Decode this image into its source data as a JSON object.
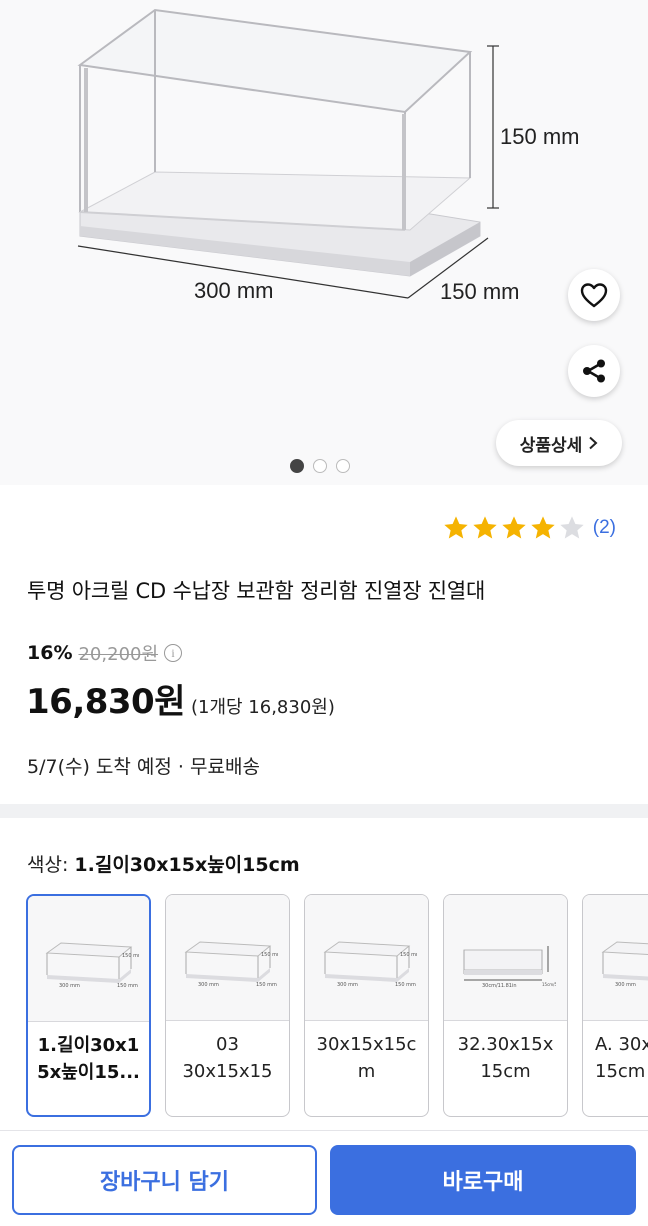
{
  "hero": {
    "dimension_height": "150 mm",
    "dimension_length": "300 mm",
    "dimension_depth": "150 mm",
    "detail_button_label": "상품상세",
    "image_count": 3,
    "active_image": 1
  },
  "rating": {
    "stars": 4,
    "max_stars": 5,
    "count_label": "(2)",
    "star_color": "#f5b301"
  },
  "product": {
    "title": "투명 아크릴 CD 수납장 보관함 정리함 진열장 진열대",
    "discount": "16%",
    "original_price": "20,200원",
    "price": "16,830원",
    "unit_price": "(1개당 16,830원)",
    "delivery": "5/7(수) 도착 예정 · 무료배송"
  },
  "option": {
    "label_prefix": "색상: ",
    "selected_value": "1.길이30x15x높이15cm",
    "items": [
      {
        "line1": "1.길이30x1",
        "line2": "5x높이15..."
      },
      {
        "line1": "03",
        "line2": "30x15x15"
      },
      {
        "line1": "30x15x15c",
        "line2": "m"
      },
      {
        "line1": "32.30x15x",
        "line2": "15cm"
      },
      {
        "line1": "A. 30x",
        "line2": "15cm"
      }
    ]
  },
  "actions": {
    "cart_label": "장바구니 담기",
    "buy_label": "바로구매"
  },
  "colors": {
    "accent": "#3b6fe0",
    "star": "#f5b301"
  }
}
